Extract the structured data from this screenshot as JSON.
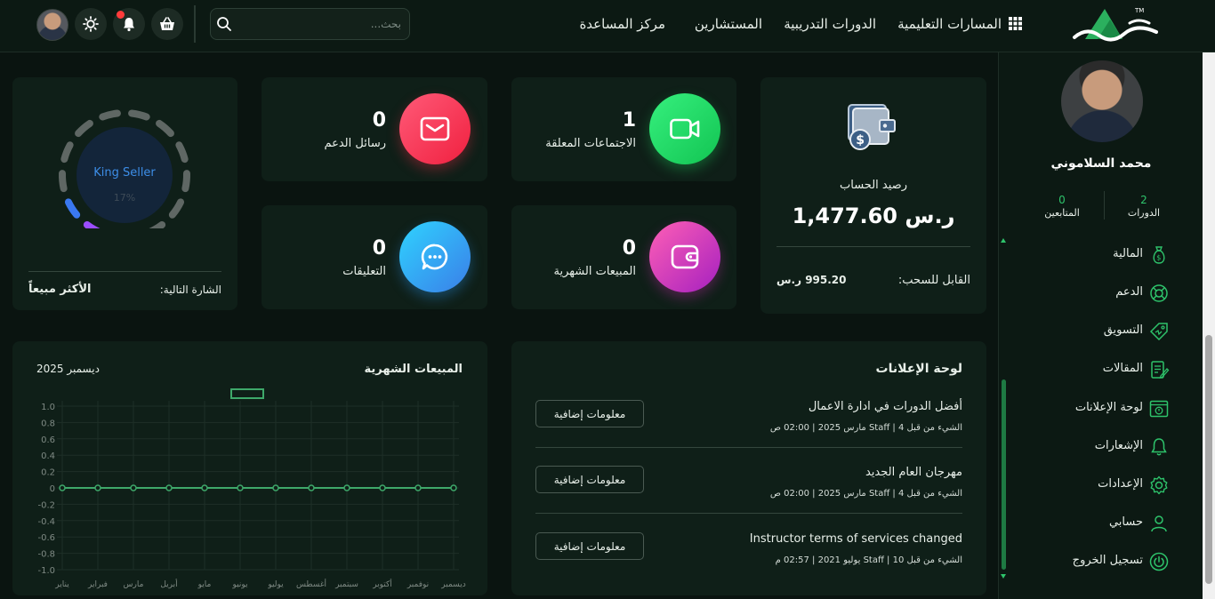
{
  "header": {
    "nav": [
      "المسارات التعليمية",
      "الدورات التدريبية",
      "المستشارين",
      "مركز المساعدة"
    ],
    "search_placeholder": "بحث..."
  },
  "sidebar": {
    "name": "محمد السلاموني",
    "stats": [
      {
        "value": "2",
        "label": "الدورات"
      },
      {
        "value": "0",
        "label": "المتابعين"
      }
    ],
    "menu": [
      {
        "label": "المالية",
        "icon": "money-bag-icon"
      },
      {
        "label": "الدعم",
        "icon": "lifebuoy-icon"
      },
      {
        "label": "التسويق",
        "icon": "tag-icon"
      },
      {
        "label": "المقالات",
        "icon": "article-icon"
      },
      {
        "label": "لوحة الإعلانات",
        "icon": "board-icon"
      },
      {
        "label": "الإشعارات",
        "icon": "bell-icon"
      },
      {
        "label": "الإعدادات",
        "icon": "gear-icon"
      },
      {
        "label": "حسابي",
        "icon": "user-icon"
      },
      {
        "label": "تسجيل الخروج",
        "icon": "power-icon"
      }
    ]
  },
  "balance": {
    "title": "رصيد الحساب",
    "value": "1,477.60 ر.س",
    "withdraw_label": "القابل للسحب:",
    "withdraw_value": "995.20 ر.س"
  },
  "stats": {
    "meetings": {
      "value": "1",
      "label": "الاجتماعات المعلقة"
    },
    "support": {
      "value": "0",
      "label": "رسائل الدعم"
    },
    "sales": {
      "value": "0",
      "label": "المبيعات الشهرية"
    },
    "comments": {
      "value": "0",
      "label": "التعليقات"
    }
  },
  "badge": {
    "name": "King Seller",
    "percent": "17%",
    "progress": 0.17,
    "next_label": "الشارة التالية:",
    "next_value": "الأكثر مبيعاً"
  },
  "announcements": {
    "title": "لوحة الإعلانات",
    "button_label": "معلومات إضافية",
    "items": [
      {
        "title": "أفضل الدورات في ادارة الاعمال",
        "meta": "الشيء من قبل  Staff | 4 مارس 2025 | 02:00 ص"
      },
      {
        "title": "مهرجان العام الجديد",
        "meta": "الشيء من قبل  Staff | 4 مارس 2025 | 02:00 ص"
      },
      {
        "title": "Instructor terms of services changed",
        "meta": "الشيء من قبل  Staff | 10 يوليو 2021 | 02:57 م"
      }
    ]
  },
  "chart_data": {
    "type": "line",
    "title": "المبيعات الشهرية",
    "date": "ديسمبر 2025",
    "categories": [
      "يناير",
      "فبراير",
      "مارس",
      "أبريل",
      "مايو",
      "يونيو",
      "يوليو",
      "أغسطس",
      "سبتمبر",
      "أكتوبر",
      "نوفمبر",
      "ديسمبر"
    ],
    "series": [
      {
        "values": [
          0,
          0,
          0,
          0,
          0,
          0,
          0,
          0,
          0,
          0,
          0,
          0
        ],
        "color": "#3ea86a"
      }
    ],
    "y_ticks": [
      "1.0",
      "0.8",
      "0.6",
      "0.4",
      "0.2",
      "0",
      "-0.2",
      "-0.4",
      "-0.6",
      "-0.8",
      "-1.0"
    ],
    "ylim": [
      -1,
      1
    ],
    "legend": "top"
  }
}
